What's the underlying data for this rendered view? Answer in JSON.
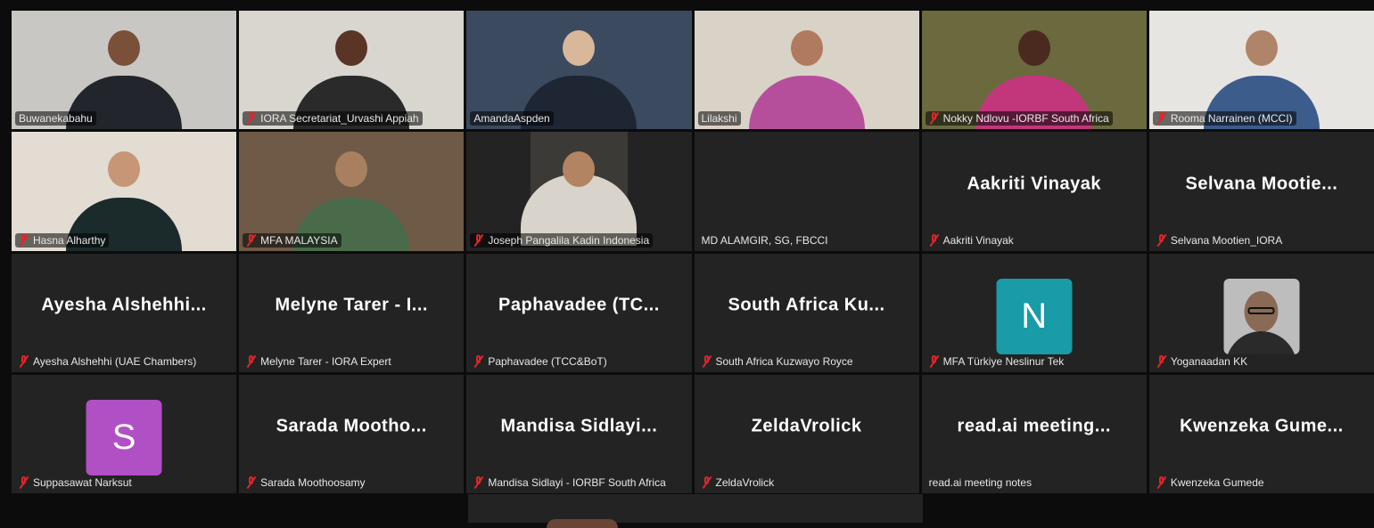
{
  "participants": [
    {
      "label": "Buwanekabahu",
      "muted": false,
      "type": "video",
      "colors": {
        "room": "#c9c7c4",
        "head": "#7a5038",
        "body": "#23252c"
      }
    },
    {
      "label": "IORA Secretariat_Urvashi Appiah",
      "muted": true,
      "type": "video",
      "colors": {
        "room": "#d8d6cf",
        "head": "#5a3526",
        "body": "#2a2a2a"
      }
    },
    {
      "label": "AmandaAspden",
      "muted": false,
      "type": "video",
      "active_speaker": true,
      "colors": {
        "room": "#3b4a5e",
        "head": "#d9b79a",
        "body": "#1e2533"
      }
    },
    {
      "label": "Lilakshi",
      "muted": false,
      "type": "video",
      "colors": {
        "room": "#d9d2c6",
        "head": "#b07a5e",
        "body": "#b54f9c"
      }
    },
    {
      "label": "Nokky Ndlovu -IORBF South Africa",
      "muted": true,
      "type": "video",
      "colors": {
        "room": "#6b6a3e",
        "head": "#4a2a1e",
        "body": "#c2377b"
      }
    },
    {
      "label": "Rooma Narrainen (MCCI)",
      "muted": true,
      "type": "video",
      "colors": {
        "room": "#e7e5e1",
        "head": "#b08468",
        "body": "#3c5c8c"
      }
    },
    {
      "label": "Hasna Alharthy",
      "muted": true,
      "type": "video",
      "colors": {
        "room": "#e2dcd2",
        "head": "#c69676",
        "body": "#1b2a2a"
      }
    },
    {
      "label": "MFA MALAYSIA",
      "muted": true,
      "type": "video",
      "colors": {
        "room": "#6e5a47",
        "head": "#a9805f",
        "body": "#4a6b4a"
      }
    },
    {
      "label": "Joseph Pangalila Kadin Indonesia",
      "muted": true,
      "type": "video-small",
      "colors": {
        "room": "#3b3a36",
        "head": "#b38462",
        "body": "#d8d4cb"
      }
    },
    {
      "label": "MD ALAMGIR, SG, FBCCI",
      "muted": false,
      "type": "empty",
      "big": ""
    },
    {
      "label": "Aakriti Vinayak",
      "muted": true,
      "type": "name",
      "big": "Aakriti Vinayak"
    },
    {
      "label": "Selvana Mootien_IORA",
      "muted": true,
      "type": "name",
      "big": "Selvana Mootie..."
    },
    {
      "label": "Ayesha Alshehhi (UAE Chambers)",
      "muted": true,
      "type": "name",
      "big": "Ayesha Alshehhi..."
    },
    {
      "label": "Melyne Tarer - IORA Expert",
      "muted": true,
      "type": "name",
      "big": "Melyne Tarer - I..."
    },
    {
      "label": "Paphavadee (TCC&BoT)",
      "muted": true,
      "type": "name",
      "big": "Paphavadee (TC..."
    },
    {
      "label": "South Africa Kuzwayo Royce",
      "muted": true,
      "type": "name",
      "big": "South Africa Ku..."
    },
    {
      "label": "MFA Türkiye Neslinur Tek",
      "muted": true,
      "type": "avatar",
      "initial": "N",
      "avatar_color": "#1a9ba8"
    },
    {
      "label": "Yoganaadan KK",
      "muted": true,
      "type": "photo"
    },
    {
      "label": "Suppasawat Narksut",
      "muted": true,
      "type": "avatar",
      "initial": "S",
      "avatar_color": "#b14fc5"
    },
    {
      "label": "Sarada Moothoosamy",
      "muted": true,
      "type": "name",
      "big": "Sarada Mootho..."
    },
    {
      "label": "Mandisa Sidlayi - IORBF South Africa",
      "muted": true,
      "type": "name",
      "big": "Mandisa Sidlayi..."
    },
    {
      "label": "ZeldaVrolick",
      "muted": true,
      "type": "name",
      "big": "ZeldaVrolick"
    },
    {
      "label": "read.ai meeting notes",
      "muted": false,
      "type": "name",
      "big": "read.ai meeting..."
    },
    {
      "label": "Kwenzeka Gumede",
      "muted": true,
      "type": "name",
      "big": "Kwenzeka Gume..."
    }
  ],
  "colors": {
    "active_border": "#23d18b",
    "tile_bg": "#232323",
    "mute": "#e0262b"
  }
}
